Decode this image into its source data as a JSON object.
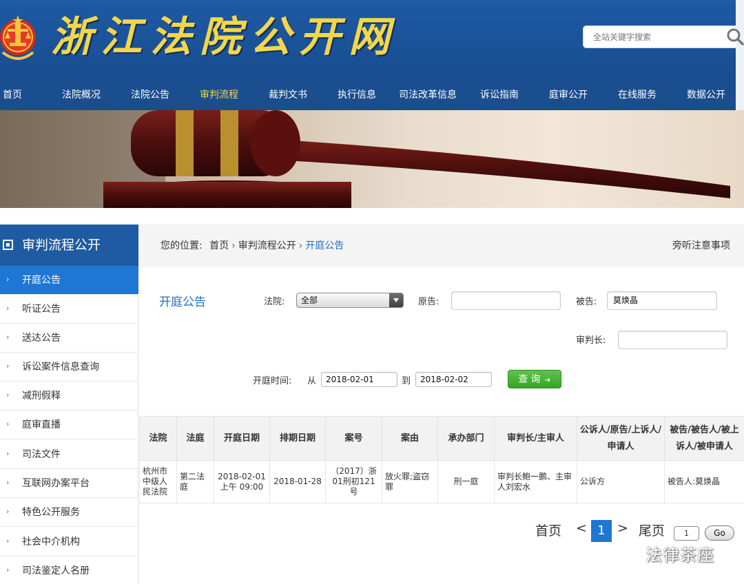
{
  "header": {
    "site_title": "浙江法院公开网",
    "search_placeholder": "全站关键字搜索",
    "search_icon": "search-icon",
    "emblem_icon": "court-emblem-icon"
  },
  "nav": {
    "items": [
      "首页",
      "法院概况",
      "法院公告",
      "审判流程",
      "裁判文书",
      "执行信息",
      "司法改革信息",
      "诉讼指南",
      "庭审公开",
      "在线服务",
      "数据公开"
    ],
    "active": "审判流程",
    "active_color": "#f5d74c",
    "bar_color": "#1b4f92"
  },
  "sidebar": {
    "title": "审判流程公开",
    "items": [
      "开庭公告",
      "听证公告",
      "送达公告",
      "诉讼案件信息查询",
      "减刑假释",
      "庭审直播",
      "司法文件",
      "互联网办案平台",
      "特色公开服务",
      "社会中介机构",
      "司法鉴定人名册"
    ],
    "active": "开庭公告",
    "active_color": "#1f77d4"
  },
  "breadcrumb": {
    "prefix": "您的位置:",
    "items": [
      "首页",
      "审判流程公开",
      "开庭公告"
    ],
    "notice_link": "旁听注意事项"
  },
  "form": {
    "section_title": "开庭公告",
    "court_label": "法院:",
    "court_value": "全部",
    "plaintiff_label": "原告:",
    "plaintiff_value": "",
    "defendant_label": "被告:",
    "defendant_value": "莫焕晶",
    "judge_label": "审判长:",
    "judge_value": "",
    "time_label": "开庭时间:",
    "from_label": "从",
    "from_value": "2018-02-01",
    "to_label": "到",
    "to_value": "2018-02-02",
    "query_button": "查询",
    "query_color": "#3fae2c"
  },
  "table": {
    "headers": [
      "法院",
      "法庭",
      "开庭日期",
      "排期日期",
      "案号",
      "案由",
      "承办部门",
      "审判长/主审人",
      "公诉人/原告/上诉人/申请人",
      "被告/被告人/被上诉人/被申请人"
    ],
    "rows": [
      [
        "杭州市中级人民法院",
        "第二法庭",
        "2018-02-01 上午 09:00",
        "2018-01-28",
        "（2017）浙01刑初121号",
        "放火罪;盗窃罪",
        "刑一庭",
        "审判长鲍一鹏、主审人刘宏水",
        "公诉方",
        "被告人:莫焕晶"
      ]
    ]
  },
  "pagination": {
    "first": "首页",
    "prev": "<",
    "current": "1",
    "next": ">",
    "last": "尾页",
    "page_input": "1",
    "go": "Go"
  },
  "watermark": {
    "text": "法律茶座",
    "icon": "wechat-icon"
  }
}
